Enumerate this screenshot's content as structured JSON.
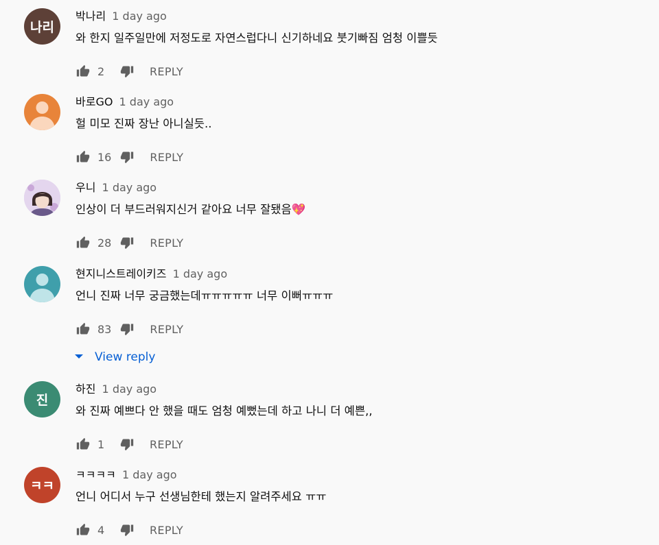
{
  "comments": [
    {
      "author": "박나리",
      "time": "1 day ago",
      "text": "와 한지 일주일만에 저정도로 자연스럽다니 신기하네요 붓기빠짐 엄청 이쁠듯",
      "likes": "2",
      "reply_label": "REPLY",
      "avatar": {
        "type": "text",
        "text": "나리",
        "color": "#5d4037"
      }
    },
    {
      "author": "바로GO",
      "time": "1 day ago",
      "text": "헐 미모 진짜 장난 아니실듯..",
      "likes": "16",
      "reply_label": "REPLY",
      "avatar": {
        "type": "default",
        "color": "#e8843a"
      }
    },
    {
      "author": "우니",
      "time": "1 day ago",
      "text": "인상이 더 부드러워지신거 같아요 너무 잘됐음💖",
      "likes": "28",
      "reply_label": "REPLY",
      "avatar": {
        "type": "photo",
        "color": "#d9c8e6"
      }
    },
    {
      "author": "현지니스트레이키즈",
      "time": "1 day ago",
      "text": "언니 진짜 너무 궁금했는데ㅠㅠㅠㅠㅠ 너무 이뻐ㅠㅠㅠ",
      "likes": "83",
      "reply_label": "REPLY",
      "view_reply_label": "View reply",
      "avatar": {
        "type": "default",
        "color": "#3f9fab"
      }
    },
    {
      "author": "하진",
      "time": "1 day ago",
      "text": "와 진짜 예쁘다 안 했을 때도 엄청 예뻤는데 하고 나니 더 예쁜,,",
      "likes": "1",
      "reply_label": "REPLY",
      "avatar": {
        "type": "text",
        "text": "진",
        "color": "#3b8b73"
      }
    },
    {
      "author": "ㅋㅋㅋㅋ",
      "time": "1 day ago",
      "text": "언니 어디서 누구 선생님한테 했는지 알려주세요 ㅠㅠ",
      "likes": "4",
      "reply_label": "REPLY",
      "avatar": {
        "type": "text",
        "text": "ㅋㅋ",
        "color": "#c0432a"
      }
    }
  ],
  "icons": {
    "like": "thumb-up-icon",
    "dislike": "thumb-down-icon",
    "expand": "caret-down-icon"
  },
  "colors": {
    "link": "#065fd4",
    "secondary_text": "#606060",
    "icon": "#606060"
  }
}
